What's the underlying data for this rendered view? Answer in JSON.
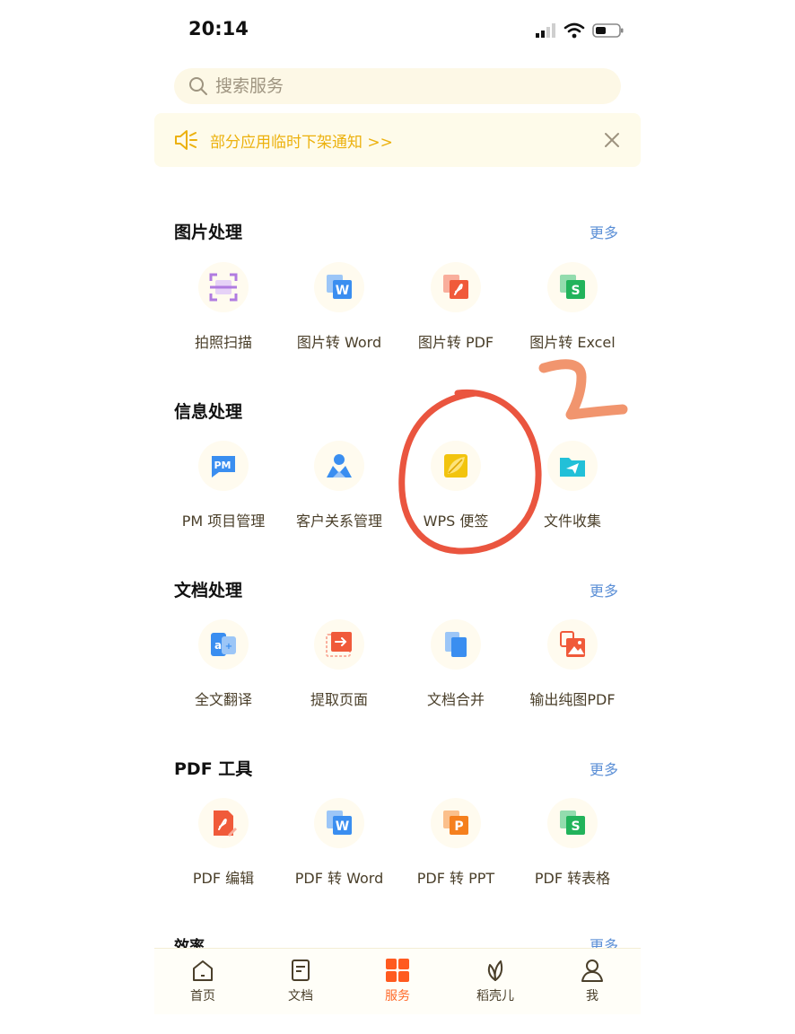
{
  "status_bar": {
    "time": "20:14"
  },
  "search": {
    "placeholder": "搜索服务"
  },
  "notice": {
    "text": "部分应用临时下架通知 >>"
  },
  "sections": [
    {
      "title": "图片处理",
      "more": "更多",
      "items": [
        {
          "label": "拍照扫描",
          "icon": "scan-icon",
          "color": "#b07be0"
        },
        {
          "label": "图片转 Word",
          "icon": "word-doc-icon",
          "color": "#3a8ef0"
        },
        {
          "label": "图片转 PDF",
          "icon": "pdf-doc-icon",
          "color": "#f05a3a"
        },
        {
          "label": "图片转 Excel",
          "icon": "excel-doc-icon",
          "color": "#22b35b"
        }
      ]
    },
    {
      "title": "信息处理",
      "more": "",
      "items": [
        {
          "label": "PM 项目管理",
          "icon": "pm-icon",
          "color": "#3a8ef0"
        },
        {
          "label": "客户关系管理",
          "icon": "customer-icon",
          "color": "#3a8ef0"
        },
        {
          "label": "WPS 便签",
          "icon": "note-leaf-icon",
          "color": "#f2c40e"
        },
        {
          "label": "文件收集",
          "icon": "folder-send-icon",
          "color": "#22c0d8"
        }
      ]
    },
    {
      "title": "文档处理",
      "more": "更多",
      "items": [
        {
          "label": "全文翻译",
          "icon": "translate-icon",
          "color": "#3a8ef0"
        },
        {
          "label": "提取页面",
          "icon": "extract-page-icon",
          "color": "#f05a3a"
        },
        {
          "label": "文档合并",
          "icon": "merge-doc-icon",
          "color": "#3a8ef0"
        },
        {
          "label": "输出纯图PDF",
          "icon": "image-pdf-icon",
          "color": "#f05a3a"
        }
      ]
    },
    {
      "title": "PDF 工具",
      "more": "更多",
      "items": [
        {
          "label": "PDF 编辑",
          "icon": "pdf-edit-icon",
          "color": "#f05a3a"
        },
        {
          "label": "PDF 转 Word",
          "icon": "word-doc-icon",
          "color": "#3a8ef0"
        },
        {
          "label": "PDF 转 PPT",
          "icon": "ppt-doc-icon",
          "color": "#f5801e"
        },
        {
          "label": "PDF 转表格",
          "icon": "excel-doc-icon",
          "color": "#22b35b"
        }
      ]
    }
  ],
  "cut_section": {
    "title": "效率",
    "more": "更多"
  },
  "tabs": [
    {
      "label": "首页",
      "icon": "home-icon"
    },
    {
      "label": "文档",
      "icon": "document-icon"
    },
    {
      "label": "服务",
      "icon": "grid-icon",
      "active": true
    },
    {
      "label": "稻壳儿",
      "icon": "leaf-icon"
    },
    {
      "label": "我",
      "icon": "user-icon"
    }
  ],
  "annotation": {
    "mark": "2",
    "color": "#e8432a"
  }
}
